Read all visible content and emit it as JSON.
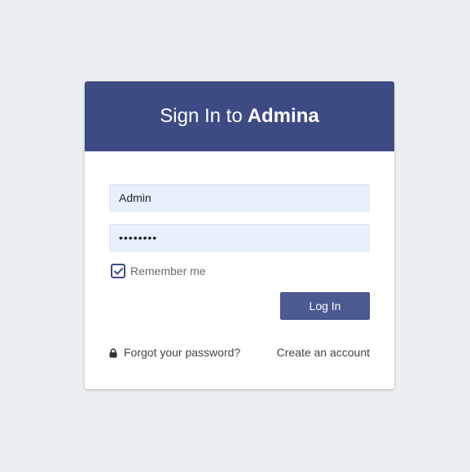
{
  "header": {
    "title_prefix": "Sign In to",
    "brand": "Admina"
  },
  "form": {
    "username_value": "Admin",
    "password_value": "••••••••",
    "remember_label": "Remember me",
    "remember_checked": true,
    "login_label": "Log In"
  },
  "links": {
    "forgot_label": "Forgot your password?",
    "forgot_icon": "lock-icon",
    "create_label": "Create an account"
  },
  "colors": {
    "header_bg": "#3d4b84",
    "button_bg": "#4c5a93",
    "page_bg": "#eceff1",
    "input_bg": "#e8f0fe"
  }
}
